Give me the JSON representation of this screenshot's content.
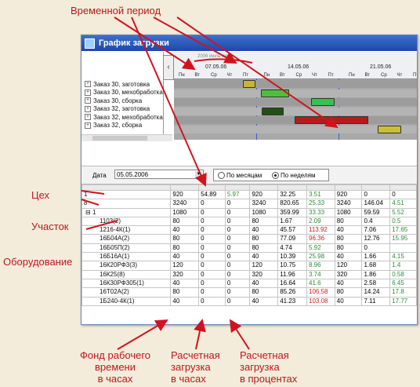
{
  "annotations": {
    "period": "Временной период",
    "workshop": "Цех",
    "section": "Участок",
    "equipment": "Оборудование",
    "fund": [
      "Фонд рабочего",
      "времени",
      "в часах"
    ],
    "load_hours": [
      "Расчетная",
      "загрузка",
      "в часах"
    ],
    "load_percent": [
      "Расчетная",
      "загрузка",
      "в процентах"
    ]
  },
  "window": {
    "title": "График загрузки"
  },
  "gantt": {
    "month_label": "2006 июль июль",
    "weeks": [
      "07.05.06",
      "14.05.06",
      "21.05.06"
    ],
    "days": [
      "Пн",
      "Вт",
      "Ср",
      "Чт",
      "Пт",
      "Пн",
      "Вт",
      "Ср",
      "Чт",
      "Пт",
      "Пн",
      "Вт",
      "Ср",
      "Чт",
      "Пт"
    ],
    "tasks": [
      {
        "label": "Заказ 30, заготовка",
        "color": "#c8b432"
      },
      {
        "label": "Заказ 30, мехобработка",
        "color": "#4cbf3f"
      },
      {
        "label": "Заказ 30, сборка",
        "color": "#35c24f"
      },
      {
        "label": "Заказ 32, заготовка",
        "color": "#234f17"
      },
      {
        "label": "Заказ 32, мехобработка",
        "color": "#b81a1a"
      },
      {
        "label": "Заказ 32, сборка",
        "color": "#cbbf30"
      }
    ]
  },
  "controls": {
    "date_label": "Дата",
    "date_value": "05.05.2006",
    "by_months": "По месяцам",
    "by_weeks": "По неделям"
  },
  "table": {
    "rows": [
      {
        "name": "1",
        "v": [
          "920",
          "54.89",
          "5.97",
          "920",
          "32.25",
          "3.51",
          "920",
          "0",
          "0"
        ],
        "c": [
          "",
          "",
          "pos",
          "",
          "",
          "pos",
          "",
          "",
          ""
        ]
      },
      {
        "name": "8",
        "v": [
          "3240",
          "0",
          "0",
          "3240",
          "820.65",
          "25.33",
          "3240",
          "146.04",
          "4.51"
        ],
        "c": [
          "",
          "",
          "",
          "",
          "",
          "pos",
          "",
          "",
          "pos"
        ]
      },
      {
        "name": "1",
        "v": [
          "1080",
          "0",
          "0",
          "1080",
          "359.99",
          "33.33",
          "1080",
          "59.59",
          "5.52"
        ],
        "c": [
          "",
          "",
          "",
          "",
          "",
          "pos",
          "",
          "",
          "pos"
        ]
      },
      {
        "name": "1103(2)",
        "v": [
          "80",
          "0",
          "0",
          "80",
          "1.67",
          "2.09",
          "80",
          "0.4",
          "0.5"
        ],
        "c": [
          "",
          "",
          "",
          "",
          "",
          "pos",
          "",
          "",
          "pos"
        ]
      },
      {
        "name": "1216-4К(1)",
        "v": [
          "40",
          "0",
          "0",
          "40",
          "45.57",
          "113.92",
          "40",
          "7.06",
          "17.65"
        ],
        "c": [
          "",
          "",
          "",
          "",
          "",
          "neg",
          "",
          "",
          "pos"
        ]
      },
      {
        "name": "16Б04А(2)",
        "v": [
          "80",
          "0",
          "0",
          "80",
          "77.09",
          "96.36",
          "80",
          "12.76",
          "15.95"
        ],
        "c": [
          "",
          "",
          "",
          "",
          "",
          "neg",
          "",
          "",
          "pos"
        ]
      },
      {
        "name": "16Б05П(2)",
        "v": [
          "80",
          "0",
          "0",
          "80",
          "4.74",
          "5.92",
          "80",
          "0",
          ""
        ],
        "c": [
          "",
          "",
          "",
          "",
          "",
          "pos",
          "",
          "",
          ""
        ]
      },
      {
        "name": "16Б16А(1)",
        "v": [
          "40",
          "0",
          "0",
          "40",
          "10.39",
          "25.98",
          "40",
          "1.66",
          "4.15"
        ],
        "c": [
          "",
          "",
          "",
          "",
          "",
          "pos",
          "",
          "",
          "pos"
        ]
      },
      {
        "name": "16К20РФ3(3)",
        "v": [
          "120",
          "0",
          "0",
          "120",
          "10.75",
          "8.96",
          "120",
          "1.68",
          "1.4"
        ],
        "c": [
          "",
          "",
          "",
          "",
          "",
          "pos",
          "",
          "",
          "pos"
        ]
      },
      {
        "name": "16К25(8)",
        "v": [
          "320",
          "0",
          "0",
          "320",
          "11.96",
          "3.74",
          "320",
          "1.86",
          "0.58"
        ],
        "c": [
          "",
          "",
          "",
          "",
          "",
          "pos",
          "",
          "",
          "pos"
        ]
      },
      {
        "name": "16К30РФ305(1)",
        "v": [
          "40",
          "0",
          "0",
          "40",
          "16.64",
          "41.6",
          "40",
          "2.58",
          "6.45"
        ],
        "c": [
          "",
          "",
          "",
          "",
          "",
          "pos",
          "",
          "",
          "pos"
        ]
      },
      {
        "name": "16Т02А(2)",
        "v": [
          "80",
          "0",
          "0",
          "80",
          "85.26",
          "106.58",
          "80",
          "14.24",
          "17.8"
        ],
        "c": [
          "",
          "",
          "",
          "",
          "",
          "neg",
          "",
          "",
          "pos"
        ]
      },
      {
        "name": "1Б240-4К(1)",
        "v": [
          "40",
          "0",
          "0",
          "40",
          "41.23",
          "103.08",
          "40",
          "7.11",
          "17.77"
        ],
        "c": [
          "",
          "",
          "",
          "",
          "",
          "neg",
          "",
          "",
          "pos"
        ]
      }
    ]
  }
}
